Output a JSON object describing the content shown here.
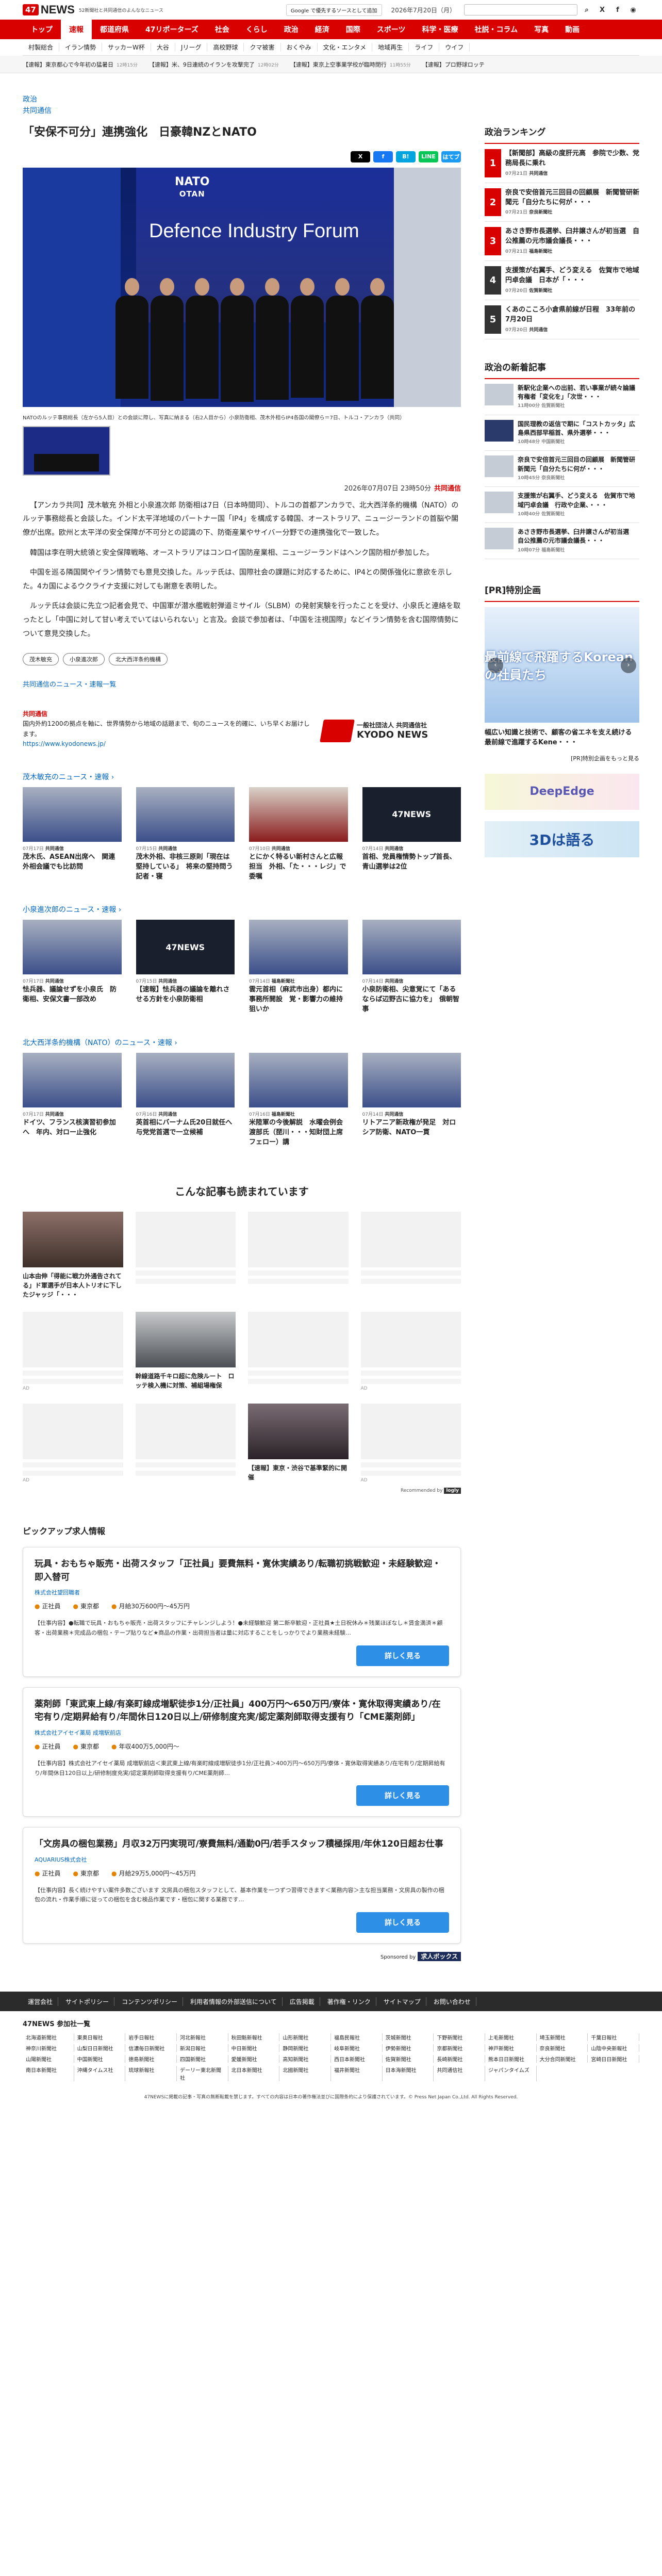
{
  "header": {
    "logo_badge": "47",
    "logo_text": "NEWS",
    "tagline": "52新聞社と共同通信のよんななニュース",
    "google_btn": "Google で優先するソースとして追加",
    "date": "2026年7月20日（月）",
    "icons": [
      "search-icon",
      "x-icon",
      "facebook-icon",
      "rss-icon"
    ]
  },
  "nav": [
    "トップ",
    "速報",
    "都道府県",
    "47リポーターズ",
    "社会",
    "くらし",
    "政治",
    "経済",
    "国際",
    "スポーツ",
    "科学・医療",
    "社説・コラム",
    "写真",
    "動画"
  ],
  "subnav": [
    "村製総合",
    "イラン情勢",
    "サッカーW杯",
    "大谷",
    "Jリーグ",
    "高校野球",
    "クマ被害",
    "おくやみ",
    "文化・エンタメ",
    "地域再生",
    "ライフ",
    "ウイフ"
  ],
  "ticker": [
    {
      "label": "【速報】東京都心で今年初の猛暑日",
      "time": "12時15分"
    },
    {
      "label": "【速報】米、9日連続のイランを攻撃完了",
      "time": "12時02分"
    },
    {
      "label": "【速報】東京上空事業学校が臨時閉行",
      "time": "11時55分"
    },
    {
      "label": "【速報】プロ野球ロッテ",
      "time": ""
    }
  ],
  "article": {
    "category": "政治",
    "source": "共同通信",
    "title": "「安保不可分」連携強化　日豪韓NZとNATO",
    "share": [
      "X",
      "f",
      "B!",
      "LINE",
      "はてブ"
    ],
    "photo_nato": "NATO",
    "photo_otan": "OTAN",
    "photo_banner": "Defence Industry Forum",
    "caption": "NATOのルッテ事務総長（左から5人目）との会談に際し、写真に納まる（右2人目から）小泉防衛相、茂木外相らIP4各国の閣僚ら＝7日、トルコ・アンカラ（共同）",
    "datetime": "2026年07月07日 23時50分",
    "datetime_source": "共同通信",
    "paragraphs": [
      "【アンカラ共同】茂木敏充 外相と小泉進次郎 防衛相は7日（日本時間同）、トルコの首都アンカラで、北大西洋条約機構（NATO）のルッテ事務総長と会談した。インド太平洋地域のパートナー国「IP4」を構成する韓国、オーストラリア、ニュージーランドの首脳や閣僚が出席。欧州と太平洋の安全保障が不可分との認識の下、防衛産業やサイバー分野での連携強化で一致した。",
      "韓国は李在明大統領と安全保障戦略、オーストラリアはコンロイ国防産業相、ニュージーランドはヘンク国防相が参加した。",
      "中国を巡る隣国関やイラン情勢でも意見交換した。ルッテ氏は、国際社会の課題に対応するために、IP4との関係強化に意欲を示した。4カ国によるウクライナ支援に対しても謝意を表明した。",
      "ルッテ氏は会談に先立つ記者会見で、中国軍が潜水艦戦射弾道ミサイル（SLBM）の発射実験を行ったことを受け、小泉氏と連絡を取ったとし「中国に対して甘い考えでいてはいられない」と言及。会談で参加者は、「中国を注視国際」などイラン情勢を含む国際情勢について意見交換した。"
    ],
    "tags": [
      "茂木敏充",
      "小泉進次郎",
      "北大西洋条約機構"
    ],
    "more_link": "共同通信のニュース・速報一覧"
  },
  "kyodo": {
    "name": "共同通信",
    "desc": "国内外約1200の拠点を軸に、世界情勢から地域の話題まで、旬のニュースを的確に、いち早くお届けします。",
    "url": "https://www.kyodonews.jp/",
    "logo_top": "一般社団法人 共同通信社",
    "logo_bottom": "KYODO NEWS"
  },
  "related": [
    {
      "title": "茂木敏充のニュース・速報 ›",
      "cards": [
        {
          "date": "07月17日",
          "src": "共同通信",
          "text": "茂木氏、ASEAN出席へ　関連外相会議でも比訪問",
          "img": "p"
        },
        {
          "date": "07月15日",
          "src": "共同通信",
          "text": "茂木外相、非核三原則「現在は堅持している」　将来の堅持問う記者・寝",
          "img": "p"
        },
        {
          "date": "07月10日",
          "src": "共同通信",
          "text": "とにかく特るい新村さんと広報担当　外相、「た・・・レジ」で委嘱",
          "img": "r"
        },
        {
          "date": "07月14日",
          "src": "共同通信",
          "text": "首相、党員権情勢トップ首長、青山選挙は2位",
          "img": "n"
        }
      ]
    },
    {
      "title": "小泉進次郎のニュース・速報 ›",
      "cards": [
        {
          "date": "07月17日",
          "src": "共同通信",
          "text": "怯兵器、議論せずを小泉氏　防衛相、安保文書一部改め",
          "img": "p"
        },
        {
          "date": "07月15日",
          "src": "共同通信",
          "text": "【速報】怯兵器の議論を離れさせる方針を小泉防衛相",
          "img": "n"
        },
        {
          "date": "07月14日",
          "src": "福島新聞社",
          "text": "雲元首相（麻武市出身）都内に事務所開設　覚・影響力の維持狙いか",
          "img": "p"
        },
        {
          "date": "07月14日",
          "src": "共同通信",
          "text": "小泉防衛相、尖意覚にて「あるならば辺野古に協力を」　俄朝智事",
          "img": "p"
        }
      ]
    },
    {
      "title": "北大西洋条約機構（NATO）のニュース・速報 ›",
      "cards": [
        {
          "date": "07月17日",
          "src": "共同通信",
          "text": "ドイツ、フランス核演習初参加へ　年内、対ロー止強化",
          "img": "p"
        },
        {
          "date": "07月16日",
          "src": "共同通信",
          "text": "英首相にバーナム氏20日就任へ　与党党首選で一立候補",
          "img": "p"
        },
        {
          "date": "07月16日",
          "src": "福島新聞社",
          "text": "米陸軍の今後解説　水曜会例会　渡部氏（琵川・・・知財団上席フェロー）講",
          "img": "p"
        },
        {
          "date": "07月14日",
          "src": "共同通信",
          "text": "リトアニア新政権が発足　対ロシア防衛、NATO一貫",
          "img": "p"
        }
      ]
    }
  ],
  "read_more": {
    "heading": "こんな記事も読まれています",
    "items": [
      {
        "text": "山本由伸「得能に戦力外通告されてる」ド軍選手が日本人トリオに下したジャッジ「・・・",
        "img": "pic",
        "sp": ""
      },
      {
        "text": "",
        "img": "",
        "sp": ""
      },
      {
        "text": "",
        "img": "",
        "sp": ""
      },
      {
        "text": "",
        "img": "",
        "sp": ""
      },
      {
        "text": "",
        "img": "",
        "sp": "AD"
      },
      {
        "text": "幹線道路千キロ超に危険ルート　ロッテ検入機に対策、補組場権保",
        "img": "tr",
        "sp": ""
      },
      {
        "text": "",
        "img": "",
        "sp": ""
      },
      {
        "text": "",
        "img": "",
        "sp": "AD"
      },
      {
        "text": "",
        "img": "",
        "sp": "AD"
      },
      {
        "text": "",
        "img": "",
        "sp": ""
      },
      {
        "text": "【速報】東京・渋谷で基準緊的に開催",
        "img": "cr",
        "sp": ""
      },
      {
        "text": "",
        "img": "",
        "sp": "AD"
      }
    ],
    "recommended": "Recommended by",
    "rec_brand": "logly"
  },
  "pickup": {
    "heading": "ピックアップ求人情報",
    "jobs": [
      {
        "title": "玩具・おもちゃ販売・出荷スタッフ「正社員」要費無料・寛休実績あり/転職初挑戦歓迎・未経験歓迎・即入替可",
        "company": "株式会社望回職者",
        "type": "正社員",
        "place": "東京都",
        "salary": "月給30万600円〜45万円",
        "desc": "【仕事内容】●転職で玩具・おもちゃ販売・出荷スタッフにチャレンジしよう！●未経験歓迎 第二新卒歓迎・正社員★土日祝休み＊残業ほぼなし＊賃金満済＊顧客・出荷業務＊完成品の梱包・テープ貼りなど★商品の作業・出荷担当者は量に対応することをしっかりでより業務未経験…",
        "btn": "詳しく見る"
      },
      {
        "title": "薬剤師「東武東上線/有楽町線成増駅徒歩1分/正社員」400万円〜650万円/寮体・寛休取得実績あり/在宅有り/定期昇給有り/年間休日120日以上/研修制度充実/認定薬剤師取得支援有り「CME薬剤師」",
        "company": "株式会社アイセイ薬局 成増駅前店",
        "type": "正社員",
        "place": "東京都",
        "salary": "年収400万5,000円〜",
        "desc": "【仕事内容】株式会社アイセイ薬局 成増駅前店＜東武東上線/有楽町線成増駅徒歩1分/正社員＞400万円〜650万円/寮体・寛休取得実績あり/在宅有り/定期昇給有り/年間休日120日以上/研修制度充実/認定薬剤師取得支援有り/CME薬剤師…",
        "btn": "詳しく見る"
      },
      {
        "title": "「文房具の梱包業務」月収32万円実現可/寮費無料/通勤0円/若手スタッフ積極採用/年休120日超お仕事",
        "company": "AQUARIUS株式会社",
        "type": "正社員",
        "place": "東京都",
        "salary": "月給29万5,000円〜45万円",
        "desc": "【仕事内容】長く続けやすい案件多数ございます 文房具の梱包スタッフとして、基本作業を一つずつ習得できます＜業務内容＞主な担当業務・文房具の製作の梱包の流れ・作業手順に従っての梱包を含む検品作業です・梱包に関する業務です…",
        "btn": "詳しく見る"
      }
    ],
    "sponsor_label": "Sponsored by",
    "sponsor_brand": "求人ボックス"
  },
  "sidebar": {
    "ranking_title": "政治ランキング",
    "ranking": [
      {
        "no": "1",
        "text": "【新聞部】高級の度肝元高　参院で少数、党務局長に乗れ",
        "date": "07月21日",
        "src": "共同通信"
      },
      {
        "no": "2",
        "text": "奈良で安倍首元三回目の回顧展　新聞管研新聞元「自分たちに何が・・・",
        "date": "07月21日",
        "src": "奈良新聞社"
      },
      {
        "no": "3",
        "text": "あさき野市長選挙、臼井譲さんが初当選　自公推薦の元市議会議長・・・",
        "date": "07月21日",
        "src": "福島新聞社"
      },
      {
        "no": "4",
        "text": "支援策が右翼手、どう変える　佐賀市で地域円卓会議　日本が「・・・",
        "date": "07月20日",
        "src": "佐賀新聞社"
      },
      {
        "no": "5",
        "text": "くあのこころ小倉県前線が日程　33年前の7月20日",
        "date": "07月20日",
        "src": "共同通信"
      }
    ],
    "new_title": "政治の新着記事",
    "newest": [
      {
        "text": "新駅化企業への出前、若い事業が続々論議　有権者「変化を」「次世・・・",
        "date": "11時00分",
        "src": "佐賀新聞社",
        "img": "a"
      },
      {
        "text": "国民理教の返信で期に「コストカッタ」広島県西部早稲首、県外選挙・・・",
        "date": "10時48分",
        "src": "中国新聞社",
        "img": "b"
      },
      {
        "text": "奈良で安倍首元三回目の回顧展　新聞管研新聞元「自分たちに何が・・・",
        "date": "10時45分",
        "src": "奈良新聞社",
        "img": "a"
      },
      {
        "text": "支援策が右翼手、どう変える　佐賀市で地域円卓会議　行政や企業、・・・",
        "date": "10時40分",
        "src": "佐賀新聞社",
        "img": "a"
      },
      {
        "text": "あさき野市長選挙、臼井譲さんが初当選　自公推薦の元市議会議長・・・",
        "date": "10時07分",
        "src": "福島新聞社",
        "img": "a"
      }
    ],
    "pr_title": "[PR]特別企画",
    "pr_banner": "最前線で飛躍するKoreanの社員たち",
    "pr_caption": "幅広い知識と技術で、顧客の省エネを支え続ける　最前線で進躍するKene・・・",
    "pr_more": "[PR]特別企画をもっと見る",
    "banner1": "DeepEdge",
    "banner2": "3Dは語る"
  },
  "footer": {
    "links": [
      "運営会社",
      "サイトポリシー",
      "コンテンツポリシー",
      "利用者情報の外部送信について",
      "広告掲載",
      "著作権・リンク",
      "サイトマップ",
      "お問い合わせ"
    ],
    "pref_title": "47NEWS 参加社一覧",
    "prefs": [
      "北海道新聞社",
      "東奥日報社",
      "岩手日報社",
      "河北新報社",
      "秋田魁新報社",
      "山形新聞社",
      "福島民報社",
      "茨城新聞社",
      "下野新聞社",
      "上毛新聞社",
      "埼玉新聞社",
      "千葉日報社",
      "神奈川新聞社",
      "山梨日日新聞社",
      "信濃毎日新聞社",
      "新潟日報社",
      "中日新聞社",
      "静岡新聞社",
      "岐阜新聞社",
      "伊勢新聞社",
      "京都新聞社",
      "神戸新聞社",
      "奈良新聞社",
      "山陰中央新報社",
      "山陽新聞社",
      "中国新聞社",
      "徳島新聞社",
      "四国新聞社",
      "愛媛新聞社",
      "高知新聞社",
      "西日本新聞社",
      "佐賀新聞社",
      "長崎新聞社",
      "熊本日日新聞社",
      "大分合同新聞社",
      "宮崎日日新聞社",
      "南日本新聞社",
      "沖縄タイムス社",
      "琉球新報社",
      "デーリー東北新聞社",
      "北日本新聞社",
      "北國新聞社",
      "福井新聞社",
      "日本海新聞社",
      "共同通信社",
      "ジャパンタイムズ"
    ],
    "copyright": "47NEWSに掲載の記事・写真の無断転載を禁じます。すべての内容は日本の著作権法並びに国際条約により保護されています。© Press Net Japan Co.,Ltd. All Rights Reserved."
  }
}
